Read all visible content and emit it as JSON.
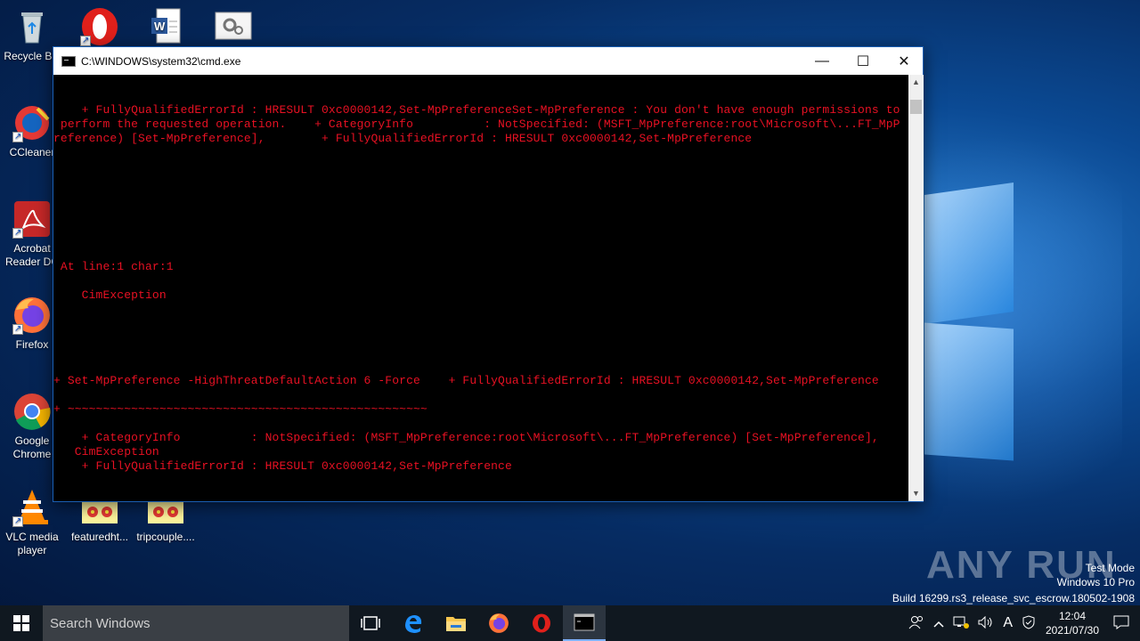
{
  "desktop": {
    "icons": [
      {
        "label": "Recycle Bin"
      },
      {
        "label": "CCleaner"
      },
      {
        "label": "Acrobat Reader DC"
      },
      {
        "label": "Firefox"
      },
      {
        "label": "Google Chrome"
      },
      {
        "label": "VLC media player"
      },
      {
        "label": "featuredht..."
      },
      {
        "label": "tripcouple...."
      }
    ]
  },
  "window": {
    "title": "C:\\WINDOWS\\system32\\cmd.exe",
    "minimize_glyph": "—",
    "maximize_glyph": "☐",
    "close_glyph": "✕",
    "console_lines": [
      "    + FullyQualifiedErrorId : HRESULT 0xc0000142,Set-MpPreferenceSet-MpPreference : You don't have enough permissions to",
      " perform the requested operation.    + CategoryInfo          : NotSpecified: (MSFT_MpPreference:root\\Microsoft\\...FT_MpP",
      "reference) [Set-MpPreference],        + FullyQualifiedErrorId : HRESULT 0xc0000142,Set-MpPreference",
      " At line:1 char:1",
      "    CimException",
      "+ Set-MpPreference -HighThreatDefaultAction 6 -Force    + FullyQualifiedErrorId : HRESULT 0xc0000142,Set-MpPreference",
      "+ ~~~~~~~~~~~~~~~~~~~~~~~~~~~~~~~~~~~~~~~~~~~~~~~~~~~",
      "    + CategoryInfo          : NotSpecified: (MSFT_MpPreference:root\\Microsoft\\...FT_MpPreference) [Set-MpPreference],",
      "   CimException",
      "    + FullyQualifiedErrorId : HRESULT 0xc0000142,Set-MpPreference"
    ]
  },
  "watermark": {
    "brand": "ANY RUN",
    "line1": "Test Mode",
    "line2": "Windows 10 Pro",
    "line3": "Build 16299.rs3_release_svc_escrow.180502-1908"
  },
  "taskbar": {
    "search_placeholder": "Search Windows",
    "time": "12:04",
    "date": "2021/07/30",
    "ime_label": "A"
  },
  "colors": {
    "console_text": "#e81123",
    "console_bg": "#000000",
    "taskbar_bg": "#101820"
  }
}
